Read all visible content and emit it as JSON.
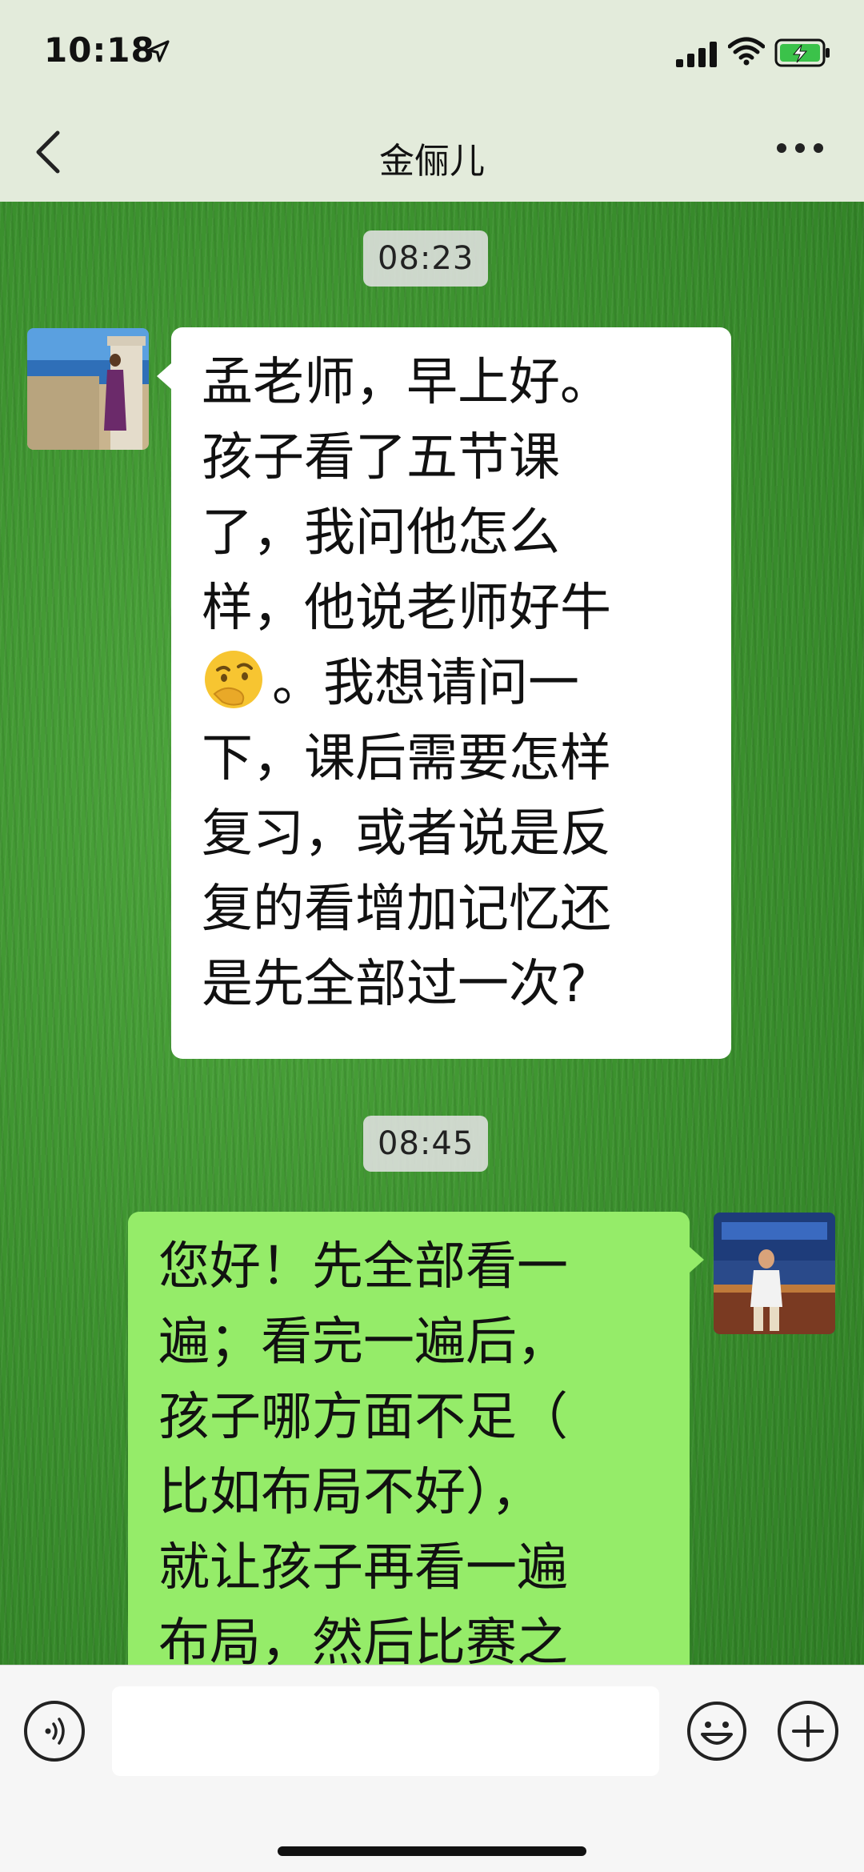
{
  "status_bar": {
    "time": "10:18",
    "icons": [
      "location-arrow-icon",
      "cellular-signal-icon",
      "wifi-icon",
      "battery-charging-icon"
    ]
  },
  "nav": {
    "back_icon": "chevron-left-icon",
    "title": "金俪儿",
    "more_icon": "more-dots-icon"
  },
  "messages": [
    {
      "timestamp": "08:23",
      "sender": "contact",
      "lines": [
        "孟老师，早上好。",
        "孩子看了五节课",
        "了，我问他怎么",
        "样，他说老师好牛",
        "。我想请问一",
        "下，课后需要怎样",
        "复习，或者说是反",
        "复的看增加记忆还",
        "是先全部过一次?"
      ],
      "emoji": "thinking-face-emoji"
    },
    {
      "timestamp": "08:45",
      "sender": "me",
      "lines": [
        "您好！先全部看一",
        "遍；看完一遍后，",
        "孩子哪方面不足（",
        "比如布局不好），",
        "就让孩子再看一遍",
        "布局，然后比赛之"
      ]
    }
  ],
  "input_bar": {
    "voice_icon": "voice-icon",
    "emoji_icon": "emoji-smile-icon",
    "plus_icon": "plus-icon"
  },
  "colors": {
    "topbar_bg": "#e3ebdb",
    "incoming_bubble": "#ffffff",
    "outgoing_bubble": "#95ec69",
    "wallpaper": "#3d932f"
  }
}
